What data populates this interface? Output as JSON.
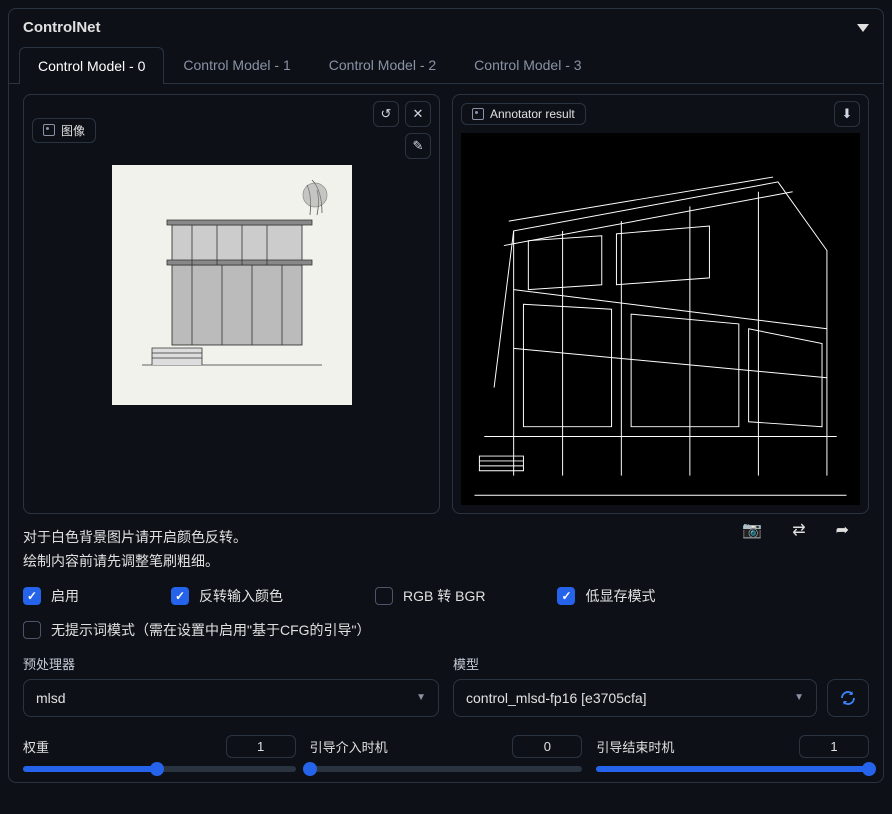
{
  "panel": {
    "title": "ControlNet"
  },
  "tabs": [
    {
      "label": "Control Model - 0",
      "active": true
    },
    {
      "label": "Control Model - 1",
      "active": false
    },
    {
      "label": "Control Model - 2",
      "active": false
    },
    {
      "label": "Control Model - 3",
      "active": false
    }
  ],
  "imageBox": {
    "leftLabel": "图像",
    "rightLabel": "Annotator result"
  },
  "hints": {
    "line1": "对于白色背景图片请开启颜色反转。",
    "line2": "绘制内容前请先调整笔刷粗细。"
  },
  "checkboxes": {
    "enable": {
      "label": "启用",
      "checked": true
    },
    "invert": {
      "label": "反转输入颜色",
      "checked": true
    },
    "rgb2bgr": {
      "label": "RGB 转 BGR",
      "checked": false
    },
    "lowvram": {
      "label": "低显存模式",
      "checked": true
    },
    "noprompt": {
      "label": "无提示词模式（需在设置中启用\"基于CFG的引导\"）",
      "checked": false
    }
  },
  "fields": {
    "preprocessor": {
      "label": "预处理器",
      "value": "mlsd"
    },
    "model": {
      "label": "模型",
      "value": "control_mlsd-fp16 [e3705cfa]"
    }
  },
  "sliders": {
    "weight": {
      "label": "权重",
      "value": "1",
      "percent": 49
    },
    "start": {
      "label": "引导介入时机",
      "value": "0",
      "percent": 0
    },
    "end": {
      "label": "引导结束时机",
      "value": "1",
      "percent": 100
    }
  },
  "icons": {
    "undo": "↺",
    "close": "✕",
    "pencil": "✎",
    "download": "⬇",
    "camera": "📷",
    "swap": "⇄",
    "send": "➦"
  }
}
